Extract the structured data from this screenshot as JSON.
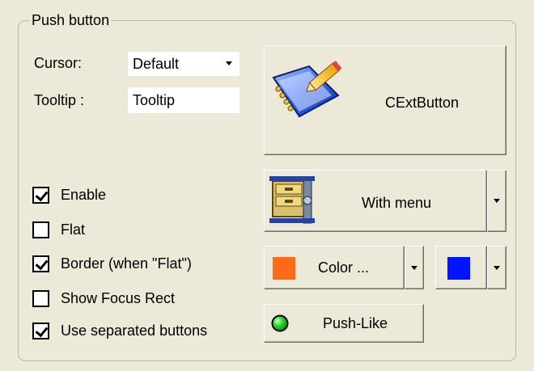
{
  "group": {
    "title": "Push button"
  },
  "cursor": {
    "label": "Cursor:",
    "value": "Default"
  },
  "tooltip": {
    "label": "Tooltip :",
    "value": "Tooltip"
  },
  "checkboxes": [
    {
      "label": "Enable",
      "checked": true
    },
    {
      "label": "Flat",
      "checked": false
    },
    {
      "label": "Border (when \"Flat\")",
      "checked": true
    },
    {
      "label": "Show Focus Rect",
      "checked": false
    },
    {
      "label": "Use separated buttons",
      "checked": true
    }
  ],
  "buttons": {
    "cext_label": "CExtButton",
    "cext_icon": "notebook-pencil-icon",
    "menu_label": "With menu",
    "menu_icon": "compressed-archive-icon",
    "color_label": "Color ...",
    "color_swatch": "#ff6a1a",
    "color2_swatch": "#0014ff",
    "pushlike_label": "Push-Like",
    "pushlike_icon": "green-led-icon"
  }
}
